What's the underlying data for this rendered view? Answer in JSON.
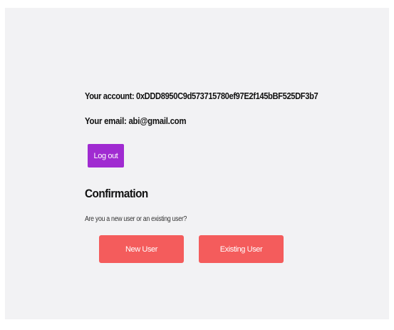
{
  "account": {
    "line": "Your account: 0xDDD8950C9d573715780ef97E2f145bBF525DF3b7"
  },
  "email": {
    "line": "Your email: abi@gmail.com"
  },
  "logout": {
    "label": "Log out"
  },
  "confirmation": {
    "title": "Confirmation",
    "question": "Are you a new user or an existing user?",
    "new_user_label": "New User",
    "existing_user_label": "Existing User"
  },
  "colors": {
    "panel_background": "#f2f2f4",
    "logout_button": "#a02bd1",
    "choice_button": "#f45c5c"
  }
}
